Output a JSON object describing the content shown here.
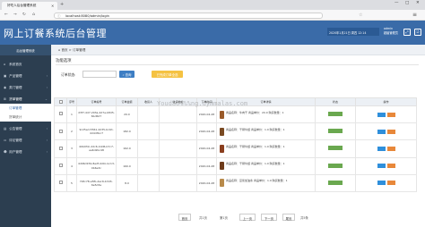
{
  "browser": {
    "tab_title": "好吃人后台管理系统",
    "url": "localhost:8080/admin/login",
    "colors": {
      "chrome": "#dcdde1",
      "toolbar": "#f7f7f8"
    }
  },
  "header": {
    "title": "网上订餐系统后台管理",
    "datetime": "2020年1月21日 周四 12:14",
    "user_line1": "admin",
    "user_line2": "超级管理员",
    "colors": {
      "header_bg": "#3a6ba8"
    }
  },
  "sidebar": {
    "title": "后台管理系统",
    "items": [
      {
        "label": "系统首页",
        "icon": "home-icon"
      },
      {
        "label": "产品管理",
        "icon": "box-icon"
      },
      {
        "label": "类门管理",
        "icon": "eye-icon"
      },
      {
        "label": "货单管理",
        "icon": "cart-icon"
      }
    ],
    "sub_items": [
      {
        "label": "订单管理"
      },
      {
        "label": "货单统计"
      }
    ],
    "more_items": [
      {
        "label": "公告管理",
        "icon": "doc-icon"
      },
      {
        "label": "评论管理",
        "icon": "comment-icon"
      },
      {
        "label": "用户管理",
        "icon": "user-icon"
      }
    ]
  },
  "main": {
    "breadcrumb_home": "首页",
    "breadcrumb_page": "订单管理",
    "section_title": "功能选项",
    "filter_label": "订单状态:",
    "filter_value": "",
    "search_label": "查询",
    "batch_label": "已完成订单全选",
    "watermark": "Youdao%%%ng.uymmalas.com",
    "table": {
      "headers": [
        "",
        "序号",
        "订单编号",
        "订单金额",
        "收货人",
        "收货地址",
        "下单时间",
        "订单详情",
        "状态",
        "操作"
      ],
      "rows": [
        {
          "index": "1",
          "order_no": "d3f7-4d7-203a-4d7e-b8d5-6bd6d7",
          "amount": "20.0",
          "receiver": "",
          "address": "",
          "time": "2020-04-28",
          "details": "商品名称：牛肉干 商品单价：20.0 购买数量：1",
          "thumb_color": "#9a5a2a"
        },
        {
          "index": "2",
          "order_no": "9c25ed-5561-4d35-bc0d-4d4d3bc7",
          "amount": "182.0",
          "receiver": "",
          "address": "",
          "time": "2020-04-28",
          "details": "商品名称：干锅牛蛙 商品单价：1.0 购买数量：1",
          "thumb_color": "#7a4a22"
        },
        {
          "index": "3",
          "order_no": "40b4fdc-d2c6-4dd6-b7c7-aa6d2bc48",
          "amount": "162.0",
          "receiver": "",
          "address": "",
          "time": "2020-04-28",
          "details": "商品名称：干锅牛蛙 商品单价：1.0 购买数量：1",
          "thumb_color": "#8a3e1e"
        },
        {
          "index": "4",
          "order_no": "4d96d159-8e2f-4d0c-bc13-0b6e3c",
          "amount": "160.0",
          "receiver": "",
          "address": "",
          "time": "2020-04-28",
          "details": "商品名称：干锅牛蛙 商品单价：1.0 购买数量：1",
          "thumb_color": "#6e3b1a"
        },
        {
          "index": "5",
          "order_no": "f18c78-e5fb-4ac6-b3d3-6e5d3a",
          "amount": "8.0",
          "receiver": "",
          "address": "",
          "time": "2020-04-28",
          "details": "商品名称：豆浆加油条 商品单价：1.0 购买数量：1",
          "thumb_color": "#b88a4a"
        }
      ]
    },
    "pager": {
      "first": "首页",
      "prev": "上一页",
      "next": "下一页",
      "last": "尾页",
      "page_info": "第1页",
      "total_pages": "共1页",
      "total_records": "共5条"
    }
  }
}
